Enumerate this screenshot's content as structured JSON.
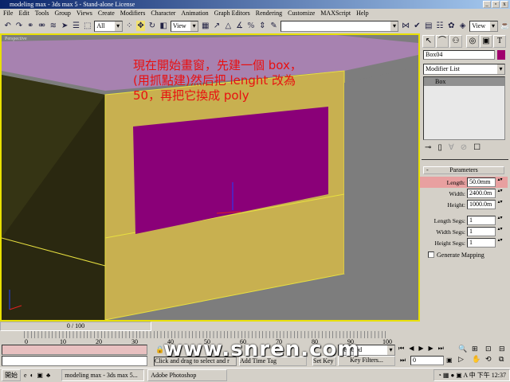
{
  "window": {
    "title": "modeling max - 3ds max 5 - Stand-alone License",
    "min": "_",
    "max": "▫",
    "close": "x"
  },
  "menu": [
    "File",
    "Edit",
    "Tools",
    "Group",
    "Views",
    "Create",
    "Modifiers",
    "Character",
    "Animation",
    "Graph Editors",
    "Rendering",
    "Customize",
    "MAXScript",
    "Help"
  ],
  "toolbar": {
    "selection_filter": "All",
    "ref_coord": "View",
    "named_sel": "",
    "render_type": "View"
  },
  "viewport": {
    "label": "Perspective",
    "instruction": "現在開始畫窗，先建一個 box，\n(用抓點建)然后把 lenght 改為\n50，再把它換成 poly"
  },
  "panel": {
    "object_name": "Box04",
    "object_color": "#a0006e",
    "modifier_list": "Modifier List",
    "stack_item": "Box",
    "rollout": "Parameters",
    "params": [
      {
        "label": "Length:",
        "value": "50.0mm",
        "highlight": true
      },
      {
        "label": "Width:",
        "value": "2400.0m"
      },
      {
        "label": "Height:",
        "value": "1000.0m"
      }
    ],
    "segs": [
      {
        "label": "Length Segs:",
        "value": "1"
      },
      {
        "label": "Width Segs:",
        "value": "1"
      },
      {
        "label": "Height Segs:",
        "value": "1"
      }
    ],
    "generate_mapping": "Generate Mapping"
  },
  "timeline": {
    "frame": "0 / 100",
    "ticks": [
      "0",
      "10",
      "20",
      "30",
      "40",
      "50",
      "60",
      "70",
      "80",
      "90",
      "100"
    ]
  },
  "status": {
    "prompt": "Click and drag to select and r",
    "add_time_tag": "Add Time Tag",
    "set_key": "Set Key",
    "key_mode": "Selected",
    "key_filters": "Key Filters...",
    "current_frame": "0"
  },
  "watermark": "www.snren.com",
  "taskbar": {
    "start": "開始",
    "tasks": [
      "modeling max - 3ds max 5...",
      "Adobe Photoshop"
    ],
    "clock": "下午 12:37"
  }
}
